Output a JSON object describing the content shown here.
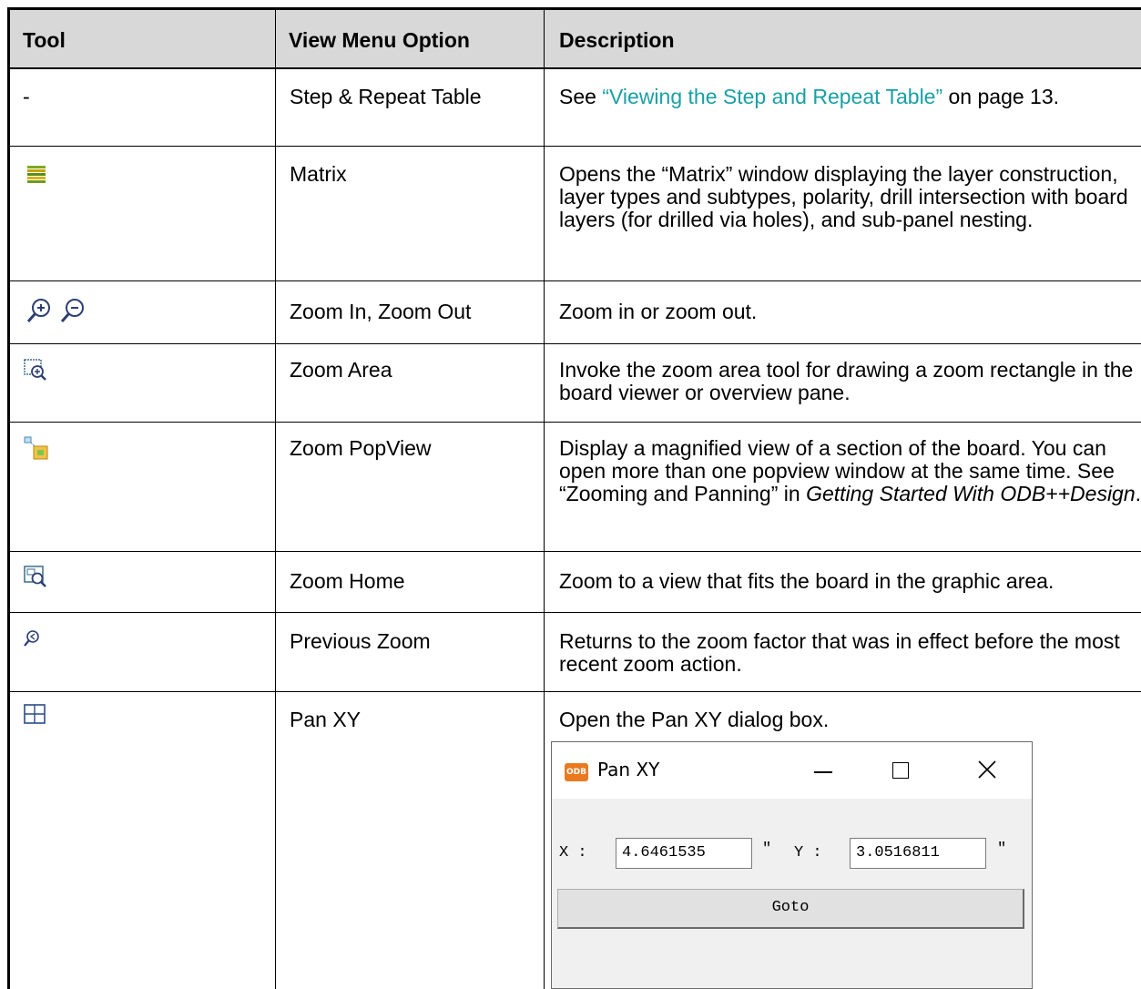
{
  "table": {
    "headers": [
      "Tool",
      "View Menu Option",
      "Description"
    ],
    "rows": [
      {
        "tool_icon": "",
        "tool_text": "-",
        "option": "Step & Repeat Table",
        "desc_prefix": "See ",
        "desc_link": "“Viewing the Step and Repeat Table”",
        "desc_suffix": " on page 13."
      },
      {
        "tool_icon": "matrix-icon",
        "option": "Matrix",
        "description": "Opens the “Matrix” window displaying the layer construction, layer types and subtypes, polarity, drill intersection with board layers (for drilled via holes), and sub-panel nesting."
      },
      {
        "tool_icon": "zoom-in-zoom-out-icons",
        "option": "Zoom In, Zoom Out",
        "description": "Zoom in or zoom out."
      },
      {
        "tool_icon": "zoom-area-icon",
        "option": "Zoom Area",
        "description": "Invoke the zoom area tool for drawing a zoom rectangle in the board viewer or overview pane."
      },
      {
        "tool_icon": "zoom-popview-icon",
        "option": "Zoom PopView",
        "desc_prefix": "Display a magnified view of a section of the board. You can open more than one popview window at the same time. See “Zooming and Panning” in ",
        "desc_italic": "Getting Started With ODB++Design",
        "desc_suffix": "."
      },
      {
        "tool_icon": "zoom-home-icon",
        "option": "Zoom Home",
        "description": "Zoom to a view that fits the board in the graphic area."
      },
      {
        "tool_icon": "previous-zoom-icon",
        "option": "Previous Zoom",
        "description": "Returns to the zoom factor that was in effect before the most recent zoom action."
      },
      {
        "tool_icon": "pan-xy-icon",
        "option": "Pan XY",
        "description": "Open the Pan XY dialog box."
      }
    ]
  },
  "dialog": {
    "logo_text": "ODB",
    "title": "Pan XY",
    "x_label": "X :",
    "x_value": "4.6461535",
    "x_unit": "\"",
    "y_label": "Y :",
    "y_value": "3.0516811",
    "y_unit": "\"",
    "goto_label": "Goto"
  },
  "colors": {
    "header_bg": "#d8d8d8",
    "link": "#1aa0a5"
  }
}
